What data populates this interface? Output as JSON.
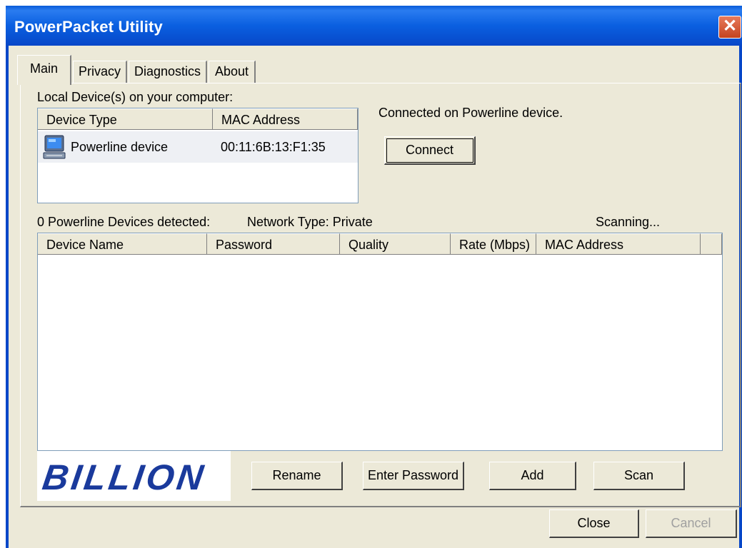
{
  "window": {
    "title": "PowerPacket Utility",
    "close_glyph": "✕"
  },
  "tabs": [
    {
      "label": "Main",
      "active": true
    },
    {
      "label": "Privacy",
      "active": false
    },
    {
      "label": "Diagnostics",
      "active": false
    },
    {
      "label": "About",
      "active": false
    }
  ],
  "local": {
    "heading": "Local Device(s) on your computer:",
    "columns": [
      "Device Type",
      "MAC Address"
    ],
    "rows": [
      {
        "icon": "computer-icon",
        "device_type": "Powerline device",
        "mac": "00:11:6B:13:F1:35"
      }
    ]
  },
  "status": {
    "connection": "Connected on Powerline device.",
    "connect_label": "Connect",
    "detected": "0 Powerline Devices detected:",
    "network_type": "Network Type: Private",
    "scanning": "Scanning..."
  },
  "devices": {
    "columns": [
      "Device Name",
      "Password",
      "Quality",
      "Rate (Mbps)",
      "MAC Address"
    ],
    "rows": []
  },
  "logo": {
    "text": "BILLION",
    "color": "#1a3a9c"
  },
  "actions": {
    "rename": "Rename",
    "enter_password": "Enter Password",
    "add": "Add",
    "scan": "Scan"
  },
  "footer": {
    "close": "Close",
    "cancel": "Cancel"
  },
  "colors": {
    "titlebar": "#0a5fe0",
    "face": "#ece9d8",
    "close_button": "#d9542e"
  }
}
